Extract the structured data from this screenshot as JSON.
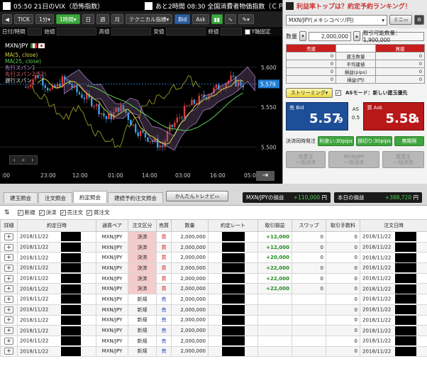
{
  "ticker": {
    "text": "05:50  21日のVIX（恐怖指数）"
  },
  "ticker2": {
    "text": "あと2時間  08:30  全国消費者物価指数（ＣＰ"
  },
  "ranking": {
    "text": "利益率トップは？約定予約ランキング！"
  },
  "toolbar": {
    "tick": "TICK",
    "interval": "1分",
    "period_active": "1時間",
    "day": "日",
    "week": "週",
    "month": "月",
    "tech": "テクニカル指標",
    "bid": "Bid",
    "ask": "Ask"
  },
  "ohlc": {
    "date": "日付/時間",
    "open": "始値",
    "high": "高値",
    "low": "安値",
    "close": "終値",
    "yaxis": "Y軸固定"
  },
  "chart": {
    "pair": "MXN/JPY",
    "legend": [
      "MA(5, close)",
      "MA(25, close)",
      "先行スパン1",
      "先行スパン2(52)",
      "遅行スパン"
    ],
    "legend_colors": [
      "#d2d23a",
      "#5dcc5d",
      "#c08dd8",
      "#e06060",
      "#e0e0e0"
    ],
    "y_ticks": [
      "5.600",
      "5.550",
      "5.500"
    ],
    "last_price": "5.579",
    "x_ticks": [
      ":00",
      "23:00",
      "12:00",
      "01:00",
      "14:00",
      "03:00",
      "16:00",
      "05:00"
    ]
  },
  "panel": {
    "pair": "MXN/JPY(メキシコペソ/円)",
    "mini": "ミニ",
    "qty_label": "数量",
    "qty": "2,000,000",
    "max_label": "取引可能数量：1,900,000",
    "sell": "売建",
    "buy": "買建",
    "rows": [
      "建玉数量",
      "平均建値",
      "損益(pips)",
      "損益(円)"
    ],
    "cell_zero": "0",
    "streaming": "ストリーミング",
    "as_mode": "ASモード：新しい建玉優先",
    "bid_label": "売 Bid",
    "bid_main": "5.57",
    "bid_sub": "9",
    "as_label": "AS",
    "spread": "0.5",
    "ask_label": "買 Ask",
    "ask_main": "5.58",
    "ask_sub": "4",
    "settle_label": "決済同時発注",
    "take_profit": "利食い:30pips",
    "stop_loss": "損切り:30pips",
    "unlimited": "無期限",
    "btn_sell_all": [
      "売建玉",
      "一括決済"
    ],
    "btn_all": [
      "MXN/JPY",
      "一括決済"
    ],
    "btn_buy_all": [
      "買建玉",
      "一括決済"
    ]
  },
  "tabs": [
    "建玉照会",
    "注文照会",
    "約定照会",
    "建続予約注文照会"
  ],
  "easy_btn": "かんたんトレナビ",
  "pnl": {
    "label": "MXN/JPYの損益",
    "value": "+110,000",
    "unit": "円"
  },
  "today": {
    "label": "本日の損益",
    "value": "+388,720",
    "unit": "円"
  },
  "filters": [
    "新規",
    "決済",
    "売注文",
    "買注文"
  ],
  "columns": [
    "詳細",
    "約定日時",
    "通貨ペア",
    "注文区分",
    "売買",
    "数量",
    "約定レート",
    "取引損益",
    "スワップ",
    "取引手数料",
    "注文日時"
  ],
  "rows": [
    {
      "date": "2018/11/22",
      "pair": "MXN/JPY",
      "kind": "決済",
      "side": "買",
      "qty": "2,000,000",
      "pl": "+12,000",
      "swap": "0",
      "fee": "0",
      "odate": "2018/11/22"
    },
    {
      "date": "2018/11/22",
      "pair": "MXN/JPY",
      "kind": "決済",
      "side": "買",
      "qty": "2,000,000",
      "pl": "+12,000",
      "swap": "0",
      "fee": "0",
      "odate": "2018/11/22"
    },
    {
      "date": "2018/11/22",
      "pair": "MXN/JPY",
      "kind": "決済",
      "side": "買",
      "qty": "2,000,000",
      "pl": "+20,000",
      "swap": "0",
      "fee": "0",
      "odate": "2018/11/22"
    },
    {
      "date": "2018/11/22",
      "pair": "MXN/JPY",
      "kind": "決済",
      "side": "買",
      "qty": "2,000,000",
      "pl": "+22,000",
      "swap": "0",
      "fee": "0",
      "odate": "2018/11/22"
    },
    {
      "date": "2018/11/22",
      "pair": "MXN/JPY",
      "kind": "決済",
      "side": "買",
      "qty": "2,000,000",
      "pl": "+22,000",
      "swap": "0",
      "fee": "0",
      "odate": "2018/11/22"
    },
    {
      "date": "2018/11/22",
      "pair": "MXN/JPY",
      "kind": "決済",
      "side": "買",
      "qty": "2,000,000",
      "pl": "+22,000",
      "swap": "0",
      "fee": "0",
      "odate": "2018/11/22"
    },
    {
      "date": "2018/11/22",
      "pair": "MXN/JPY",
      "kind": "新規",
      "side": "売",
      "qty": "2,000,000",
      "pl": "",
      "swap": "",
      "fee": "0",
      "odate": "2018/11/22"
    },
    {
      "date": "2018/11/22",
      "pair": "MXN/JPY",
      "kind": "新規",
      "side": "売",
      "qty": "2,000,000",
      "pl": "",
      "swap": "",
      "fee": "0",
      "odate": "2018/11/22"
    },
    {
      "date": "2018/11/22",
      "pair": "MXN/JPY",
      "kind": "新規",
      "side": "売",
      "qty": "2,000,000",
      "pl": "",
      "swap": "",
      "fee": "0",
      "odate": "2018/11/22"
    },
    {
      "date": "2018/11/22",
      "pair": "MXN/JPY",
      "kind": "新規",
      "side": "売",
      "qty": "2,000,000",
      "pl": "",
      "swap": "",
      "fee": "0",
      "odate": "2018/11/22"
    },
    {
      "date": "2018/11/22",
      "pair": "MXN/JPY",
      "kind": "新規",
      "side": "売",
      "qty": "2,000,000",
      "pl": "",
      "swap": "",
      "fee": "0",
      "odate": "2018/11/22"
    },
    {
      "date": "2018/11/22",
      "pair": "MXN/JPY",
      "kind": "新規",
      "side": "売",
      "qty": "2,000,000",
      "pl": "",
      "swap": "",
      "fee": "0",
      "odate": "2018/11/22"
    }
  ]
}
